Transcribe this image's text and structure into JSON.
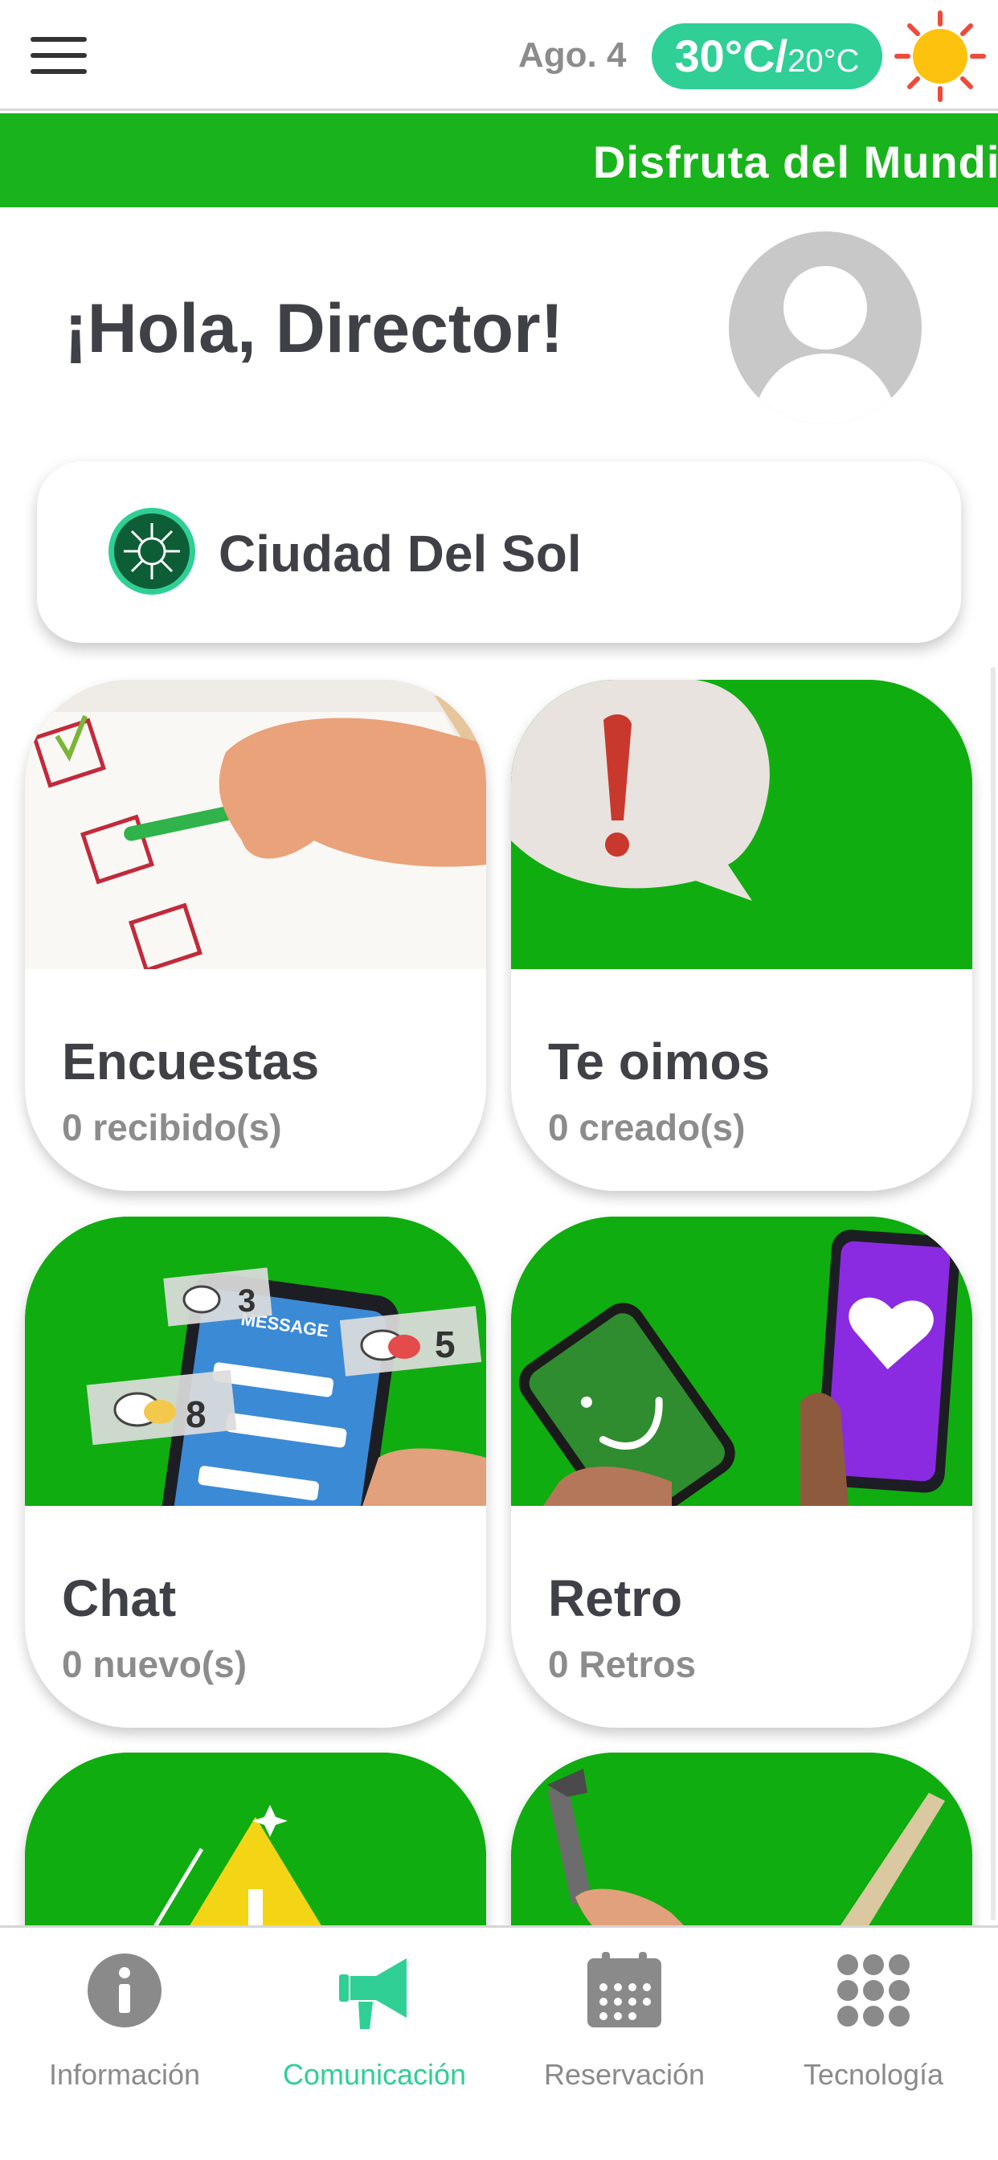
{
  "header": {
    "menu_icon": "hamburger-icon",
    "date": "Ago. 4",
    "temp_high": "30°C/",
    "temp_low": "20°C",
    "weather_icon": "sun-icon"
  },
  "banner": {
    "text": "Disfruta del Mundial"
  },
  "greeting": {
    "text": "¡Hola, Director!"
  },
  "community": {
    "name": "Ciudad Del Sol",
    "logo_icon": "sun-emblem-icon"
  },
  "tiles": [
    {
      "title": "Encuestas",
      "subtitle": "0 recibido(s)",
      "image": "survey-checklist-image"
    },
    {
      "title": "Te oimos",
      "subtitle": "0 creado(s)",
      "image": "exclamation-bubble-image"
    },
    {
      "title": "Chat",
      "subtitle": "0 nuevo(s)",
      "image": "phone-messages-image",
      "badges": [
        "3",
        "5",
        "8"
      ],
      "phone_text": "MESSAGE"
    },
    {
      "title": "Retro",
      "subtitle": "0 Retros",
      "image": "phones-smile-heart-image"
    },
    {
      "title": "",
      "subtitle": "",
      "image": "warning-sign-image"
    },
    {
      "title": "",
      "subtitle": "",
      "image": "wrench-tool-image"
    }
  ],
  "bottom_nav": [
    {
      "label": "Información",
      "icon": "info-icon",
      "active": false
    },
    {
      "label": "Comunicación",
      "icon": "megaphone-icon",
      "active": true
    },
    {
      "label": "Reservación",
      "icon": "calendar-icon",
      "active": false
    },
    {
      "label": "Tecnología",
      "icon": "grid-icon",
      "active": false
    }
  ],
  "colors": {
    "brand_green": "#19b41c",
    "accent_teal": "#2fcf95",
    "text_dark": "#404047",
    "text_muted": "#8c8c8c"
  }
}
